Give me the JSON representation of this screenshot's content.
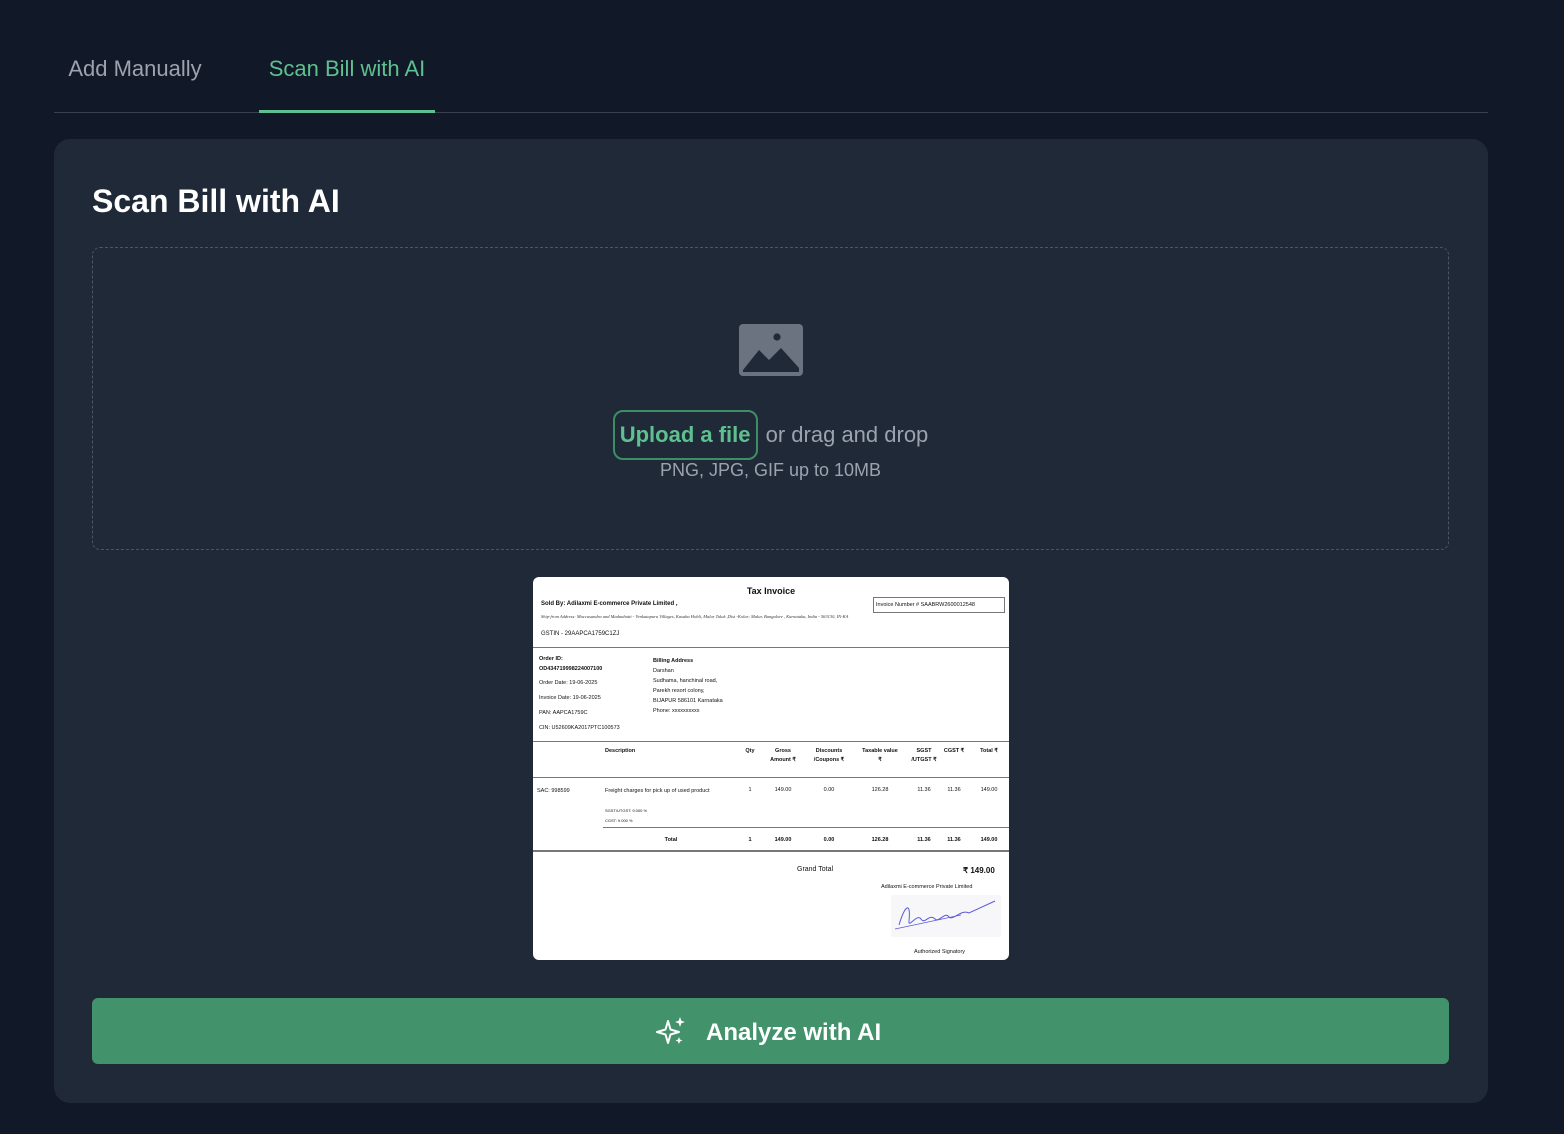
{
  "tabs": {
    "manual": "Add Manually",
    "scan": "Scan Bill with AI"
  },
  "card": {
    "title": "Scan Bill with AI"
  },
  "upload": {
    "link": "Upload a file",
    "rest": "or drag and drop",
    "hint": "PNG, JPG, GIF up to 10MB"
  },
  "invoice": {
    "title": "Tax Invoice",
    "sold_by": "Sold By: Adilaxmi E-commerce Private Limited ,",
    "ship_from": "Ship-from Address: Maccasandra and Madnahatti - Venkatapura Villages, Kasaba Hobli, Malur Taluk ,Dist -Kolar; Malur, Bangalore , Karnataka, India - 563130, IN-KA",
    "gstin": "GSTIN - 29AAPCA1759C1ZJ",
    "invoice_number": "Invoice Number # SAABRW2600012548",
    "order_id_label": "Order ID:",
    "order_id": "OD434719998224007100",
    "order_date": "Order Date: 19-06-2025",
    "invoice_date": "Invoice Date: 19-06-2025",
    "pan": "PAN: AAPCA1759C",
    "cin": "CIN: U52609KA2017PTC100573",
    "billing_label": "Billing Address",
    "billing_lines": "Darshan\nSudhama, hanchinal road,\nParekh resort colony,\nBIJAPUR 586101 Karnataka\nPhone: xxxxxxxxxx",
    "columns": {
      "description": "Description",
      "qty": "Qty",
      "gross": "Gross Amount ₹",
      "discounts": "Discounts /Coupons ₹",
      "taxable": "Taxable value ₹",
      "sgst": "SGST /UTGST ₹",
      "cgst": "CGST ₹",
      "total": "Total ₹"
    },
    "row": {
      "sac": "SAC: 998599",
      "description": "Freight charges for pick up of used product",
      "sgst_rate": "SGST/UTGST: 9.000 %",
      "cgst_rate": "CGST: 9.000 %",
      "qty": "1",
      "gross": "149.00",
      "discounts": "0.00",
      "taxable": "126.28",
      "sgst": "11.36",
      "cgst": "11.36",
      "total": "149.00"
    },
    "totals": {
      "label": "Total",
      "qty": "1",
      "gross": "149.00",
      "discounts": "0.00",
      "taxable": "126.28",
      "sgst": "11.36",
      "cgst": "11.36",
      "total": "149.00"
    },
    "grand_total_label": "Grand Total",
    "grand_total": "₹ 149.00",
    "company": "Adilaxmi E-commerce Private Limited",
    "signatory": "Authorized Signatory"
  },
  "analyze_button": "Analyze with AI",
  "colors": {
    "accent": "#5fc08f",
    "button": "#42936b",
    "background": "#111827",
    "card": "#1f2937"
  }
}
